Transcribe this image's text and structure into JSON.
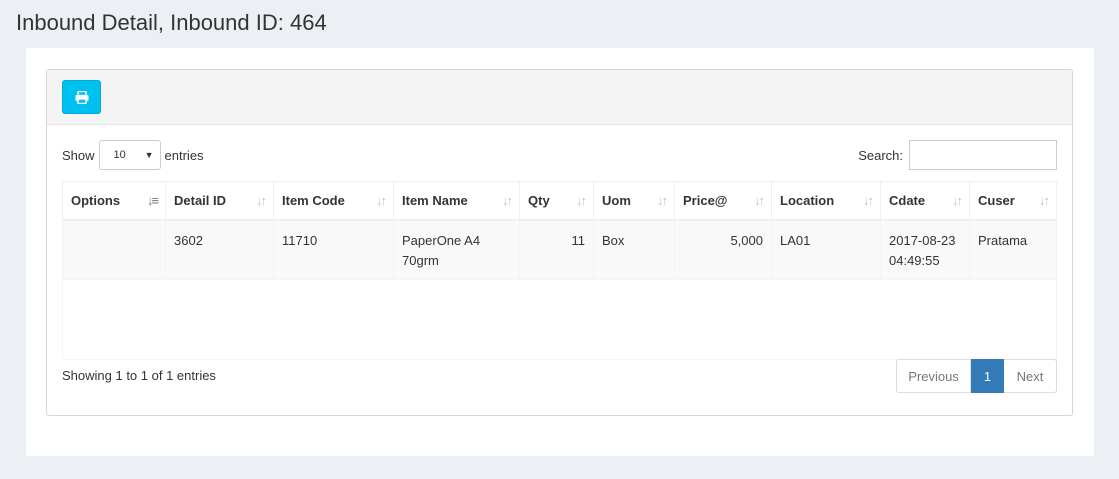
{
  "page": {
    "title": "Inbound Detail, Inbound ID: 464"
  },
  "toolbar": {
    "print_icon": "print-icon"
  },
  "length": {
    "show_label": "Show",
    "value": "10",
    "entries_label": "entries"
  },
  "search": {
    "label": "Search:",
    "value": ""
  },
  "table": {
    "headers": [
      "Options",
      "Detail ID",
      "Item Code",
      "Item Name",
      "Qty",
      "Uom",
      "Price@",
      "Location",
      "Cdate",
      "Cuser"
    ],
    "rows": [
      {
        "options": "",
        "detail_id": "3602",
        "item_code": "11710",
        "item_name_1": "PaperOne A4",
        "item_name_2": "70grm",
        "qty": "11",
        "uom": "Box",
        "price": "5,000",
        "location": "LA01",
        "cdate_1": "2017-08-23",
        "cdate_2": "04:49:55",
        "cuser": "Pratama"
      }
    ]
  },
  "footer": {
    "info": "Showing 1 to 1 of 1 entries"
  },
  "pagination": {
    "previous": "Previous",
    "current": "1",
    "next": "Next"
  },
  "colors": {
    "accent": "#00c0ef",
    "active_page": "#337ab7",
    "background": "#ecf0f5"
  }
}
